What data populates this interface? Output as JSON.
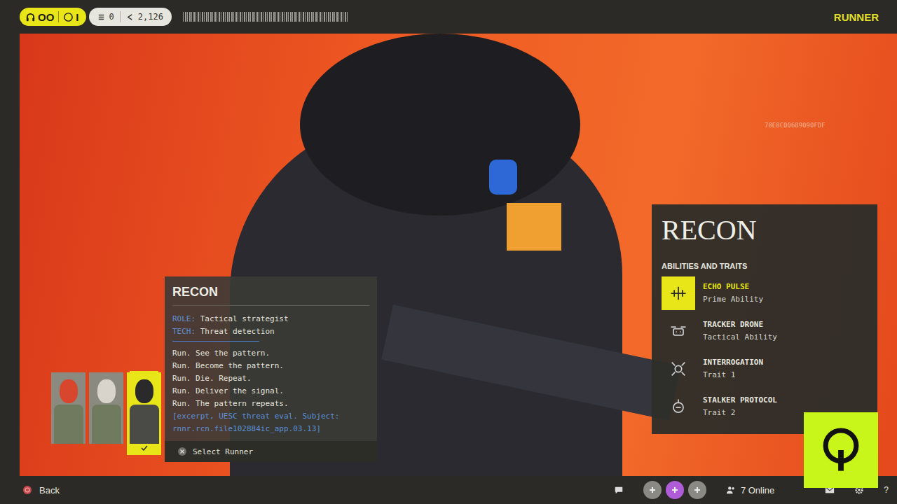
{
  "top_bar": {
    "party": [
      "OO",
      "I"
    ],
    "stats": [
      "0",
      "2,126"
    ],
    "title": "RUNNER"
  },
  "scene": {
    "id_code": "78E8C00689090FDF"
  },
  "info_card": {
    "title": "RECON",
    "role_label": "ROLE:",
    "role": "Tactical strategist",
    "tech_label": "TECH:",
    "tech": "Threat detection",
    "lines": [
      "Run. See the pattern.",
      "Run. Become the pattern.",
      "Run. Die. Repeat.",
      "Run. Deliver the signal.",
      "Run. The pattern repeats."
    ],
    "excerpt": "[excerpt, UESC threat eval. Subject: rnnr.rcn.file102884ic_app.03.13]",
    "action": "Select Runner"
  },
  "runners": [
    {
      "selected": false,
      "color": "#d9462e"
    },
    {
      "selected": false,
      "color": "#d8d4cc"
    },
    {
      "selected": true,
      "color": "#2a2a2a"
    }
  ],
  "abilities": {
    "title": "RECON",
    "heading": "ABILITIES AND TRAITS",
    "items": [
      {
        "name": "ECHO PULSE",
        "type": "Prime Ability",
        "selected": true,
        "kind": "pulse"
      },
      {
        "name": "TRACKER DRONE",
        "type": "Tactical Ability",
        "selected": false,
        "kind": "drone"
      },
      {
        "name": "INTERROGATION",
        "type": "Trait 1",
        "selected": false,
        "kind": "interrogation"
      },
      {
        "name": "STALKER PROTOCOL",
        "type": "Trait 2",
        "selected": false,
        "kind": "stalker"
      }
    ]
  },
  "bottom_bar": {
    "back": "Back",
    "online": "7 Online",
    "help": "?",
    "platform_buttons": [
      {
        "selected": false
      },
      {
        "selected": true
      },
      {
        "selected": false
      }
    ]
  }
}
